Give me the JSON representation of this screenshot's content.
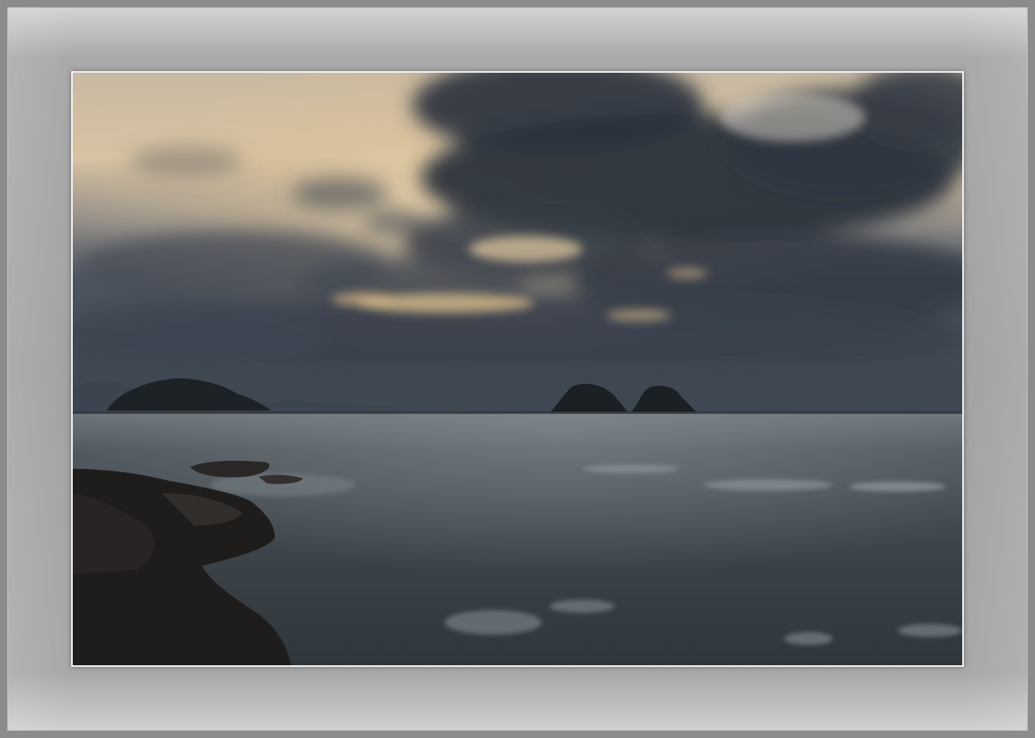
{
  "scene": {
    "type": "framed-landscape-photo",
    "subject": "seascape-at-dusk",
    "colors": {
      "mat": "#a4a4a4",
      "photo_border": "#f2f2f2",
      "sky_glow": "#e8cfa8",
      "cloud_dark": "#2e3540",
      "sea": "#3a4249",
      "rock": "#1e1c1b"
    }
  }
}
